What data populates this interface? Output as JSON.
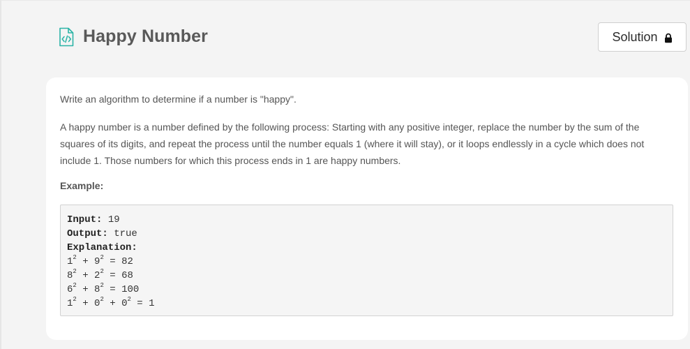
{
  "header": {
    "title": "Happy Number",
    "solution_label": "Solution"
  },
  "description": {
    "intro": "Write an algorithm to determine if a number is \"happy\".",
    "definition": "A happy number is a number defined by the following process: Starting with any positive integer, replace the number by the sum of the squares of its digits, and repeat the process until the number equals 1 (where it will stay), or it loops endlessly in a cycle which does not include 1. Those numbers for which this process ends in 1 are happy numbers.",
    "example_label": "Example:"
  },
  "example": {
    "input_key": "Input:",
    "input_value": "19",
    "output_key": "Output:",
    "output_value": "true",
    "explanation_key": "Explanation:",
    "steps": [
      {
        "terms": [
          "1",
          "9"
        ],
        "result": "82"
      },
      {
        "terms": [
          "8",
          "2"
        ],
        "result": "68"
      },
      {
        "terms": [
          "6",
          "8"
        ],
        "result": "100"
      },
      {
        "terms": [
          "1",
          "0",
          "0"
        ],
        "result": "1"
      }
    ],
    "exponent": "2"
  },
  "colors": {
    "icon_accent": "#2ab3a6",
    "title": "#595959",
    "body_text": "#555555"
  },
  "icons": {
    "title_icon": "code-file-icon",
    "solution_icon": "lock-icon"
  }
}
